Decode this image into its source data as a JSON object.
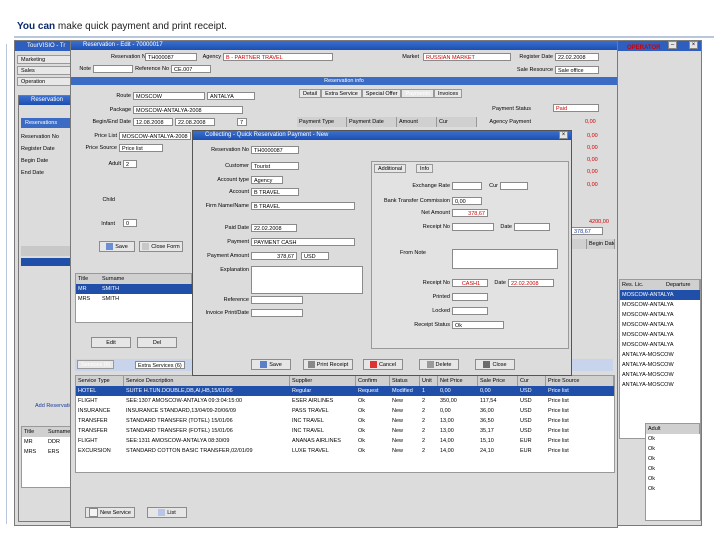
{
  "caption": {
    "bold": "You can",
    "rest": " make quick payment and print receipt."
  },
  "app": {
    "title": "TourVISIO - Tr",
    "menu": [
      "Marketing",
      "Sales",
      "Operation"
    ]
  },
  "reservation_window": {
    "title": "Reservation - Edit - 70000017",
    "reservation_no_label": "Reservation No",
    "reservation_no": "TH000087",
    "agency_label": "Agency",
    "agency": "B - PARTNER TRAVEL",
    "market_label": "Market",
    "market": "RUSSIAN MARKET",
    "register_date_label": "Register Date",
    "register_date": "22.02.2008",
    "note_label": "Note",
    "note": "",
    "reference_no_label": "Reference No",
    "reference_no": "CE.007",
    "sales_resource_label": "Sale Resource",
    "sales_resource": "Sale office",
    "res_info": "Reservation info",
    "route_label": "Route",
    "route": "MOSCOW",
    "route2": "ANTALYA",
    "package_label": "Package",
    "package": "MOSCOW-ANTALYA-2008",
    "begin_end_label": "Begin/End Date",
    "begin_date": "12.08.2008",
    "end_date": "22.08.2008",
    "nights": "7",
    "price_list_label": "Price List",
    "price_list": "MOSCOW-ANTALYA-2008",
    "price_source_label": "Price Source",
    "price_source": "Price list",
    "adult_label": "Adult",
    "adult": "2",
    "child_label": "Child",
    "child": "0",
    "infant_label": "Infant",
    "infant": "0",
    "tabs": [
      "Detail",
      "Extra Service",
      "Special Offer",
      "Payments",
      "Invoices"
    ],
    "pay_columns": [
      "Payment Type",
      "Payment Date",
      "Amount",
      "Cur"
    ],
    "payment_status_label": "Payment Status",
    "payment_status": "Paid",
    "agency_payment_label": "Agency Payment",
    "agency_payment": "0,00",
    "amounts": [
      "0,00",
      "0,00",
      "0,00",
      "0,00",
      "0,00"
    ],
    "amount_red1": "428,67",
    "total1": "4200,00",
    "total2": "378,67",
    "res_header": [
      "Res.",
      "Begin Date",
      "End Date"
    ],
    "operator": "OPERATOR"
  },
  "left_panel": {
    "title": "Reservation",
    "tab": "Reservations",
    "labels": [
      "Reservation No",
      "Register Date",
      "Begin Date",
      "End Date"
    ]
  },
  "collection_dialog": {
    "title": "Collecting - Quick Reservation Payment - New",
    "res_no_label": "Reservation No",
    "res_no": "TH0000087",
    "customer_label": "Customer",
    "customer": "Tourist",
    "account_type_label": "Account type",
    "account_type": "Agency",
    "account_label": "Account",
    "account": "B TRAVEL",
    "firm_label": "Firm Name/Name",
    "firm": "B TRAVEL",
    "paid_date_label": "Paid Date",
    "paid_date": "22.02.2008",
    "payment_label": "Payment",
    "payment": "PAYMENT CASH",
    "payment_amount_label": "Payment Amount",
    "payment_amount": "378,67",
    "payment_cur": "USD",
    "explanation_label": "Explanation",
    "explanation": "",
    "reference_label": "Reference",
    "reference": "",
    "invoice_label": "Invoice Print/Date",
    "invoice": "",
    "tabs": [
      "Additional",
      "Info"
    ],
    "exchange_rate_label": "Exchange Rate",
    "exchange_rate": "",
    "cur_label": "Cur",
    "cur": "",
    "bank_label": "Bank Transfer Commission",
    "bank": "0,00",
    "net_amount_label": "Net Amount",
    "net_amount": "378,67",
    "receipt_no_label": "Receipt No",
    "receipt_no": "",
    "date_label": "Date",
    "date": "",
    "from_note_label": "From Note",
    "from_note": "",
    "receipt_no2_label": "Receipt No",
    "receipt_no2": "CASH1",
    "receipt_date_label": "Date",
    "receipt_date": "22.02.2008",
    "printed_label": "Printed",
    "printed": "",
    "locked_label": "Locked",
    "locked": "",
    "receipt_status_label": "Receipt Status",
    "receipt_status": "Ok",
    "buttons": [
      "Save",
      "Print Receipt",
      "Cancel",
      "Delete",
      "Close"
    ]
  },
  "services": {
    "tab": "Services (6)",
    "filter": "Extra Services (6)",
    "columns": [
      "Service Type",
      "Service Description",
      "Supplier",
      "Confirm",
      "Status",
      "Unit",
      "Net Price",
      "Sale Price",
      "Cur",
      "Price Source"
    ],
    "rows": [
      [
        "HOTEL",
        "SUITE H.TUN.DOUBLE,DB,AI,HB,15/01/06",
        "Regular",
        "Request",
        "Modified",
        "1",
        "0,00",
        "0,00",
        "USD",
        "Price list"
      ],
      [
        "FLIGHT",
        "SEE:1307 AMOSCOW-ANTALYA 09:3:04:15:00",
        "ESER AIRLINES",
        "Ok",
        "New",
        "2",
        "350,00",
        "117,54",
        "USD",
        "Price list"
      ],
      [
        "INSURANCE",
        "INSURANCE STANDARD,13/04/09-20/06/09",
        "PASS TRAVEL",
        "Ok",
        "New",
        "2",
        "0,00",
        "36,00",
        "USD",
        "Price list"
      ],
      [
        "TRANSFER",
        "STANDARD TRANSFER (TOTEL) 15/01/06",
        "INC TRAVEL",
        "Ok",
        "New",
        "2",
        "13,00",
        "36,50",
        "USD",
        "Price list"
      ],
      [
        "TRANSFER",
        "STANDARD TRANSFER (FOTEL) 15/01/06",
        "INC TRAVEL",
        "Ok",
        "New",
        "2",
        "13,00",
        "35,17",
        "USD",
        "Price list"
      ],
      [
        "FLIGHT",
        "SEE:1311 AMOSCOW-ANTALYA 08:30/09",
        "ANANAS AIRLINES",
        "Ok",
        "New",
        "2",
        "14,00",
        "15,10",
        "EUR",
        "Price list"
      ],
      [
        "EXCURSION",
        "STANDARD COTTON BASIC TRANSFER,02/01/09",
        "LUXE TRAVEL",
        "Ok",
        "New",
        "2",
        "14,00",
        "24,10",
        "EUR",
        "Price list"
      ]
    ],
    "new_service": "New Service",
    "list_btn": "List"
  },
  "right_list": {
    "header": [
      "Res. Lic.",
      "Departure"
    ],
    "rows": [
      "MOSCOW-ANTALYA",
      "MOSCOW-ANTALYA",
      "MOSCOW-ANTALYA",
      "MOSCOW-ANTALYA",
      "MOSCOW-ANTALYA",
      "MOSCOW-ANTALYA",
      "ANTALYA-MOSCOW",
      "ANTALYA-MOSCOW",
      "ANTALYA-MOSCOW",
      "ANTALYA-MOSCOW"
    ],
    "small": [
      "Bonus",
      "Age Group",
      "Adult"
    ],
    "rightcol": [
      "Ok",
      "Ok",
      "Ok",
      "Ok",
      "Ok",
      "Ok"
    ]
  },
  "customers": {
    "columns": [
      "Title",
      "Surname"
    ],
    "rows": [
      [
        "MR",
        "SMITH"
      ],
      [
        "MRS",
        "SMITH"
      ]
    ],
    "left_rows": [
      "MR",
      "MRS"
    ],
    "left_names": [
      "DDR",
      "ERS"
    ],
    "side_labels": [
      "Add Reservation"
    ]
  }
}
